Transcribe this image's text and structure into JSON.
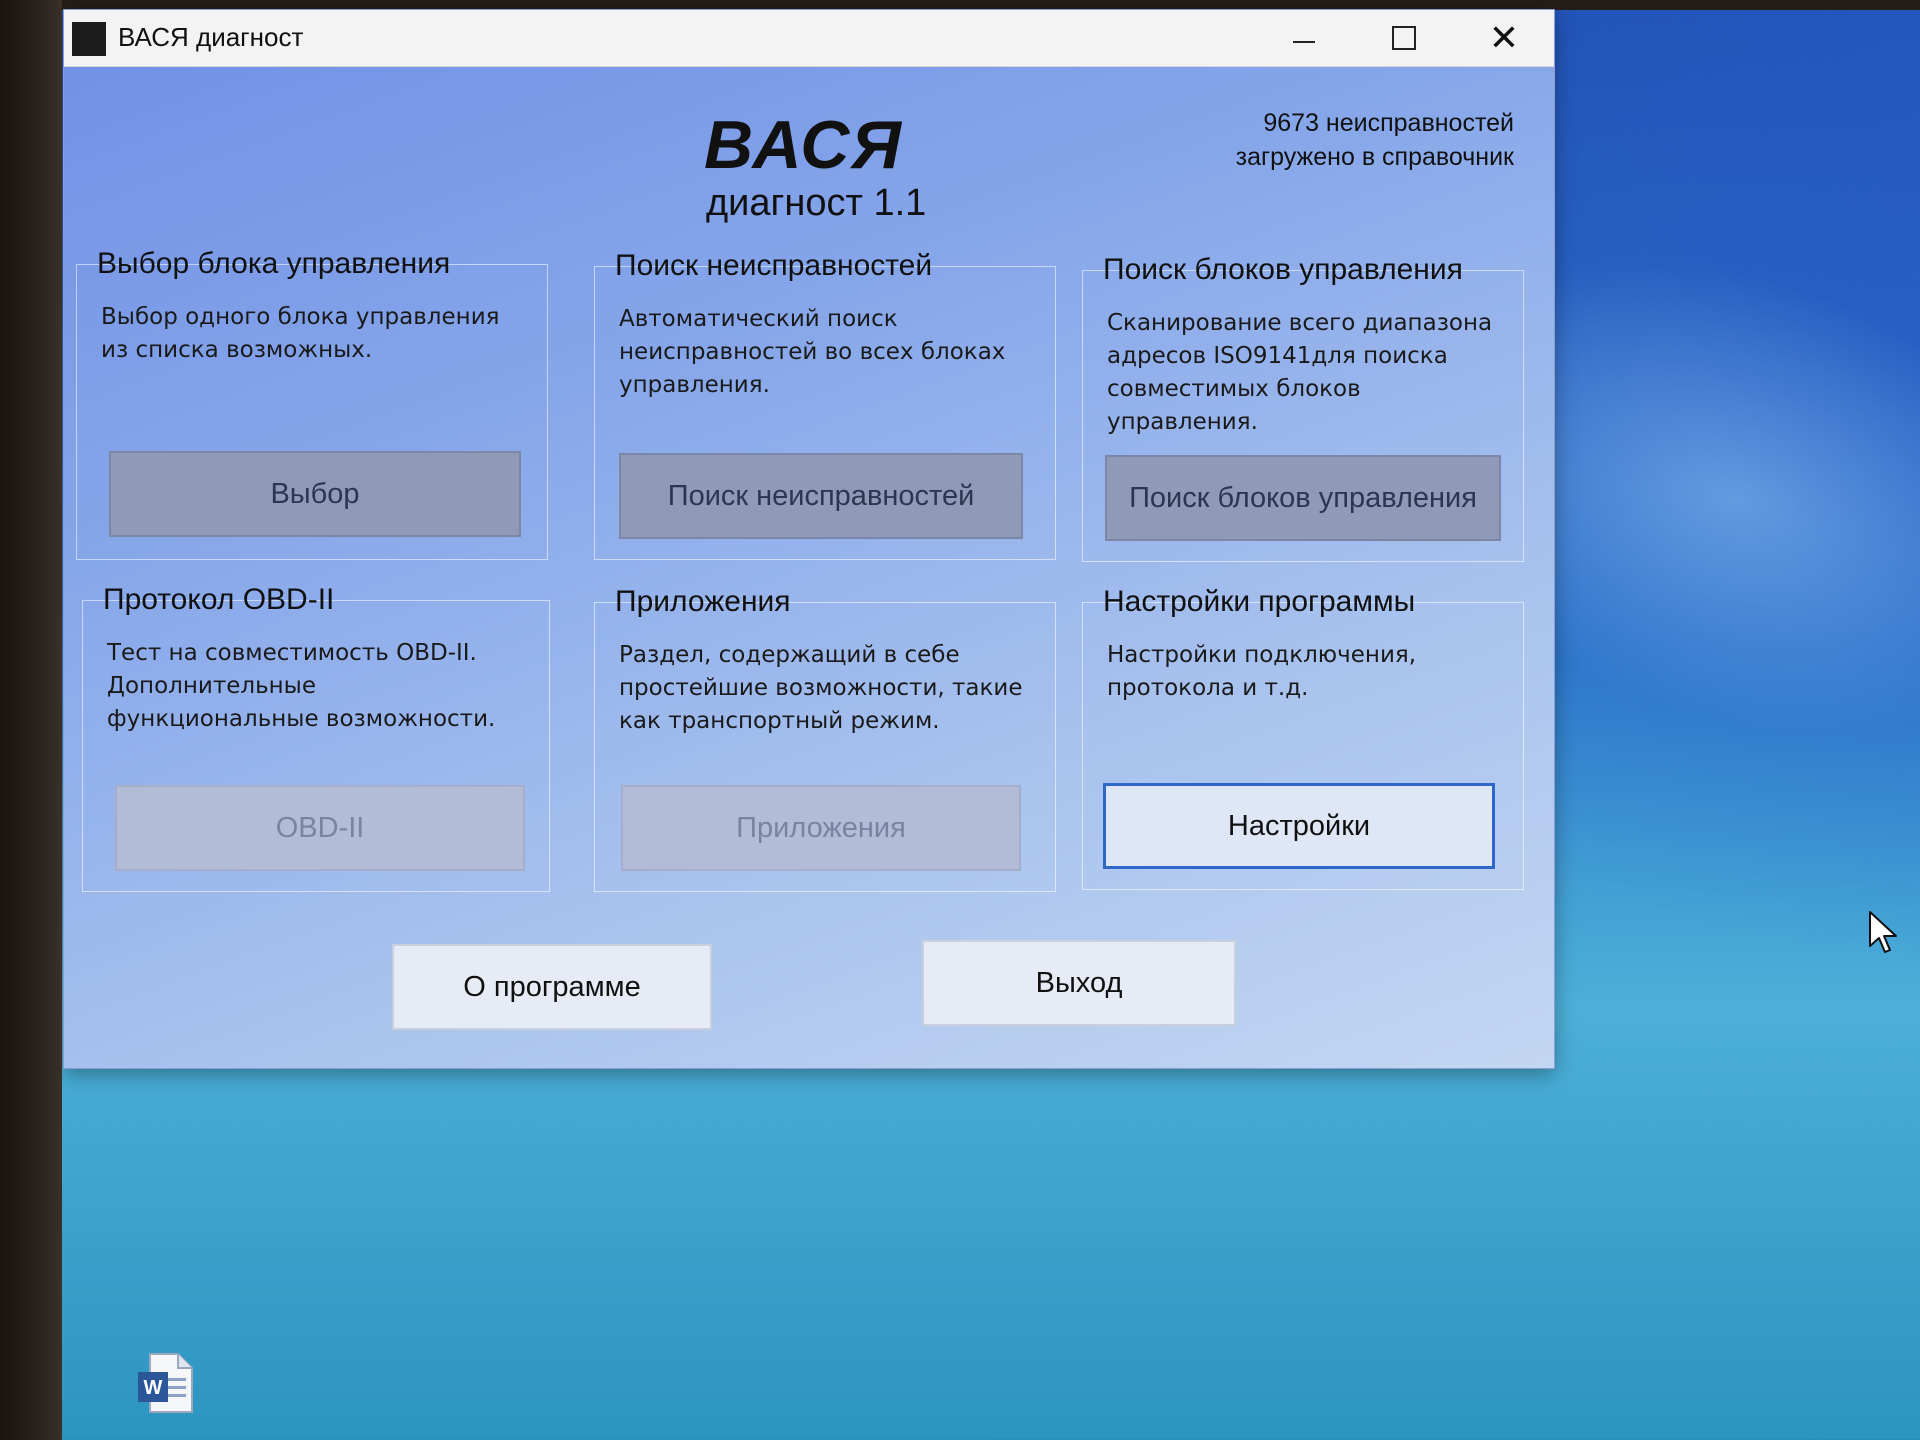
{
  "window": {
    "title": "ВАСЯ диагност",
    "controls": {
      "minimize": "minimize",
      "maximize": "maximize",
      "close": "✕"
    }
  },
  "header": {
    "logo": "ВАСЯ",
    "subtitle": "диагност 1.1",
    "faults_line1": "9673 неисправностей",
    "faults_line2": "загружено в справочник"
  },
  "groups": [
    {
      "title": "Выбор блока управления",
      "description": "Выбор одного блока управления из списка возможных.",
      "button": "Выбор",
      "state": "gray"
    },
    {
      "title": "Поиск неисправностей",
      "description": "Автоматический поиск неисправностей во всех блоках управления.",
      "button": "Поиск неисправностей",
      "state": "gray"
    },
    {
      "title": "Поиск блоков управления",
      "description": "Сканирование всего диапазона адресов ISO9141для поиска совместимых блоков управления.",
      "button": "Поиск блоков управления",
      "state": "gray"
    },
    {
      "title": "Протокол OBD-II",
      "description": "Тест на совместимость OBD-II. Дополнительные функциональные возможности.",
      "button": "OBD-II",
      "state": "disabled"
    },
    {
      "title": "Приложения",
      "description": "Раздел, содержащий в себе простейшие возможности, такие как транспортный режим.",
      "button": "Приложения",
      "state": "disabled"
    },
    {
      "title": "Настройки программы",
      "description": "Настройки подключения, протокола и т.д.",
      "button": "Настройки",
      "state": "active"
    }
  ],
  "footer": {
    "about_label": "О программе",
    "exit_label": "Выход"
  },
  "desktop": {
    "icon": "word-document-icon",
    "accent": "#2f66c9"
  }
}
